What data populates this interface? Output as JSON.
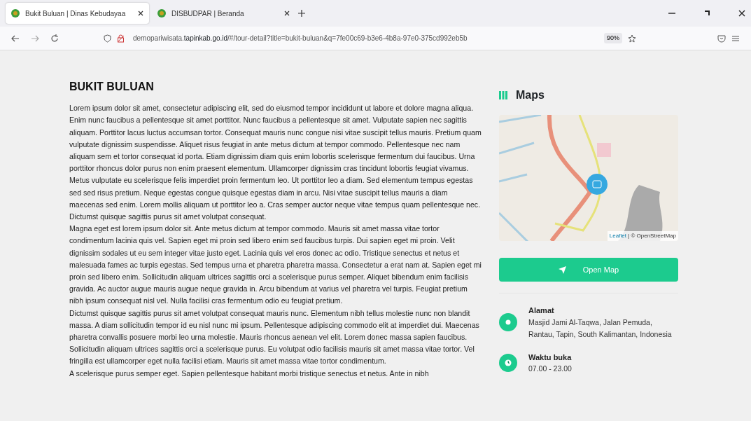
{
  "browser": {
    "tabs": [
      {
        "title": "Bukit Buluan | Dinas Kebudayaa",
        "selected": true
      },
      {
        "title": "DISBUDPAR | Beranda",
        "selected": false
      }
    ],
    "url_prefix": "demopariwisata.",
    "url_domain": "tapinkab.go.id",
    "url_path": "/#/tour-detail?title=bukit-buluan&q=7fe00c69-b3e6-4b8a-97e0-375cd992eb5b",
    "zoom": "90%"
  },
  "article": {
    "title": "BUKIT BULUAN",
    "paragraphs": [
      "Lorem ipsum dolor sit amet, consectetur adipiscing elit, sed do eiusmod tempor incididunt ut labore et dolore magna aliqua. Enim nunc faucibus a pellentesque sit amet porttitor. Nunc faucibus a pellentesque sit amet. Vulputate sapien nec sagittis aliquam. Porttitor lacus luctus accumsan tortor. Consequat mauris nunc congue nisi vitae suscipit tellus mauris. Pretium quam vulputate dignissim suspendisse. Aliquet risus feugiat in ante metus dictum at tempor commodo. Pellentesque nec nam aliquam sem et tortor consequat id porta. Etiam dignissim diam quis enim lobortis scelerisque fermentum dui faucibus. Urna porttitor rhoncus dolor purus non enim praesent elementum. Ullamcorper dignissim cras tincidunt lobortis feugiat vivamus. Metus vulputate eu scelerisque felis imperdiet proin fermentum leo. Ut porttitor leo a diam. Sed elementum tempus egestas sed sed risus pretium. Neque egestas congue quisque egestas diam in arcu. Nisi vitae suscipit tellus mauris a diam maecenas sed enim. Lorem mollis aliquam ut porttitor leo a. Cras semper auctor neque vitae tempus quam pellentesque nec. Dictumst quisque sagittis purus sit amet volutpat consequat.",
      "Magna eget est lorem ipsum dolor sit. Ante metus dictum at tempor commodo. Mauris sit amet massa vitae tortor condimentum lacinia quis vel. Sapien eget mi proin sed libero enim sed faucibus turpis. Dui sapien eget mi proin. Velit dignissim sodales ut eu sem integer vitae justo eget. Lacinia quis vel eros donec ac odio. Tristique senectus et netus et malesuada fames ac turpis egestas. Sed tempus urna et pharetra pharetra massa. Consectetur a erat nam at. Sapien eget mi proin sed libero enim. Sollicitudin aliquam ultrices sagittis orci a scelerisque purus semper. Aliquet bibendum enim facilisis gravida. Ac auctor augue mauris augue neque gravida in. Arcu bibendum at varius vel pharetra vel turpis. Feugiat pretium nibh ipsum consequat nisl vel. Nulla facilisi cras fermentum odio eu feugiat pretium.",
      "Dictumst quisque sagittis purus sit amet volutpat consequat mauris nunc. Elementum nibh tellus molestie nunc non blandit massa. A diam sollicitudin tempor id eu nisl nunc mi ipsum. Pellentesque adipiscing commodo elit at imperdiet dui. Maecenas pharetra convallis posuere morbi leo urna molestie. Mauris rhoncus aenean vel elit. Lorem donec massa sapien faucibus. Sollicitudin aliquam ultrices sagittis orci a scelerisque purus. Eu volutpat odio facilisis mauris sit amet massa vitae tortor. Vel fringilla est ullamcorper eget nulla facilisi etiam. Mauris sit amet massa vitae tortor condimentum.",
      "A scelerisque purus semper eget. Sapien pellentesque habitant morbi tristique senectus et netus. Ante in nibh"
    ]
  },
  "maps": {
    "title": "Maps",
    "attribution_link": "Leaflet",
    "attribution_text": "| © OpenStreetMap",
    "button": "Open Map"
  },
  "info": [
    {
      "kind": "location",
      "label": "Alamat",
      "value": "Masjid Jami Al-Taqwa, Jalan Pemuda, Rantau, Tapin, South Kalimantan, Indonesia"
    },
    {
      "kind": "clock",
      "label": "Waktu buka",
      "value": "07.00 - 23.00"
    }
  ]
}
